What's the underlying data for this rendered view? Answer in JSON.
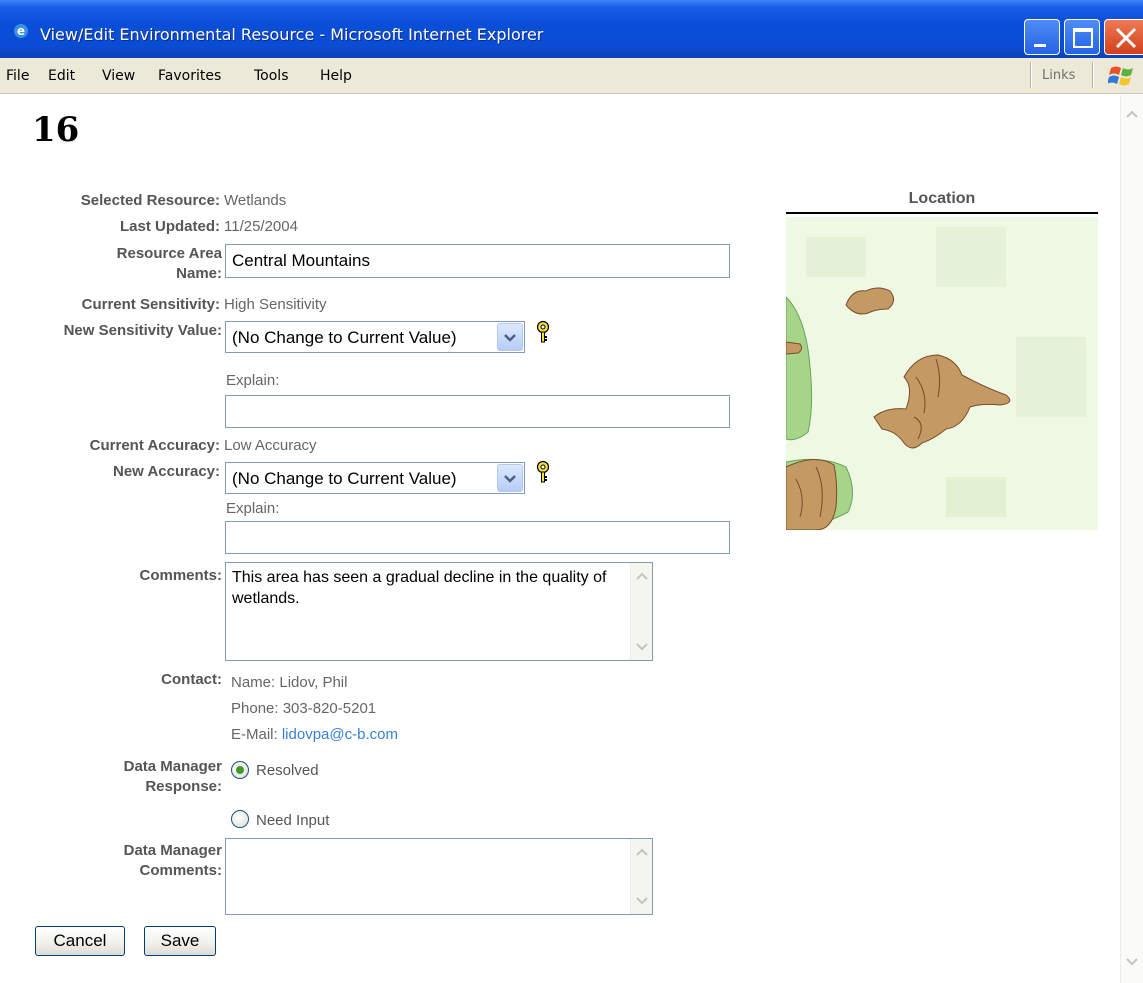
{
  "window": {
    "title": "View/Edit Environmental Resource - Microsoft Internet Explorer"
  },
  "menu": {
    "items": [
      "File",
      "Edit",
      "View",
      "Favorites",
      "Tools",
      "Help"
    ],
    "links_label": "Links"
  },
  "page": {
    "title": "16"
  },
  "form": {
    "selected_resource": {
      "label": "Selected Resource:",
      "value": "Wetlands"
    },
    "last_updated": {
      "label": "Last Updated:",
      "value": "11/25/2004"
    },
    "resource_area_name": {
      "label": "Resource Area Name:",
      "value": "Central Mountains"
    },
    "current_sensitivity": {
      "label": "Current Sensitivity:",
      "value": "High Sensitivity"
    },
    "new_sensitivity": {
      "label": "New Sensitivity Value:",
      "selected": "(No Change to Current Value)",
      "explain_label": "Explain:",
      "explain_value": ""
    },
    "current_accuracy": {
      "label": "Current Accuracy:",
      "value": "Low Accuracy"
    },
    "new_accuracy": {
      "label": "New Accuracy:",
      "selected": "(No Change to Current Value)",
      "explain_label": "Explain:",
      "explain_value": ""
    },
    "comments": {
      "label": "Comments:",
      "value": "This area has seen a gradual decline in the quality of wetlands."
    },
    "contact": {
      "label": "Contact:",
      "name_label": "Name:",
      "name": "Lidov, Phil",
      "phone_label": "Phone:",
      "phone": "303-820-5201",
      "email_label": "E-Mail:",
      "email": "lidovpa@c-b.com"
    },
    "dm_response": {
      "label": "Data Manager Response:",
      "options": [
        "Resolved",
        "Need Input"
      ],
      "selected": "Resolved"
    },
    "dm_comments": {
      "label": "Data Manager Comments:",
      "value": ""
    }
  },
  "buttons": {
    "cancel": "Cancel",
    "save": "Save"
  },
  "location": {
    "title": "Location"
  },
  "colors": {
    "titlebar": "#0a4ed9",
    "menubar": "#ece9d8",
    "label_text": "#555555",
    "link": "#3a7fd0",
    "map_background": "#eaf6dc",
    "map_wetland_green": "#9ad07e",
    "map_area_brown": "#c49a64"
  }
}
